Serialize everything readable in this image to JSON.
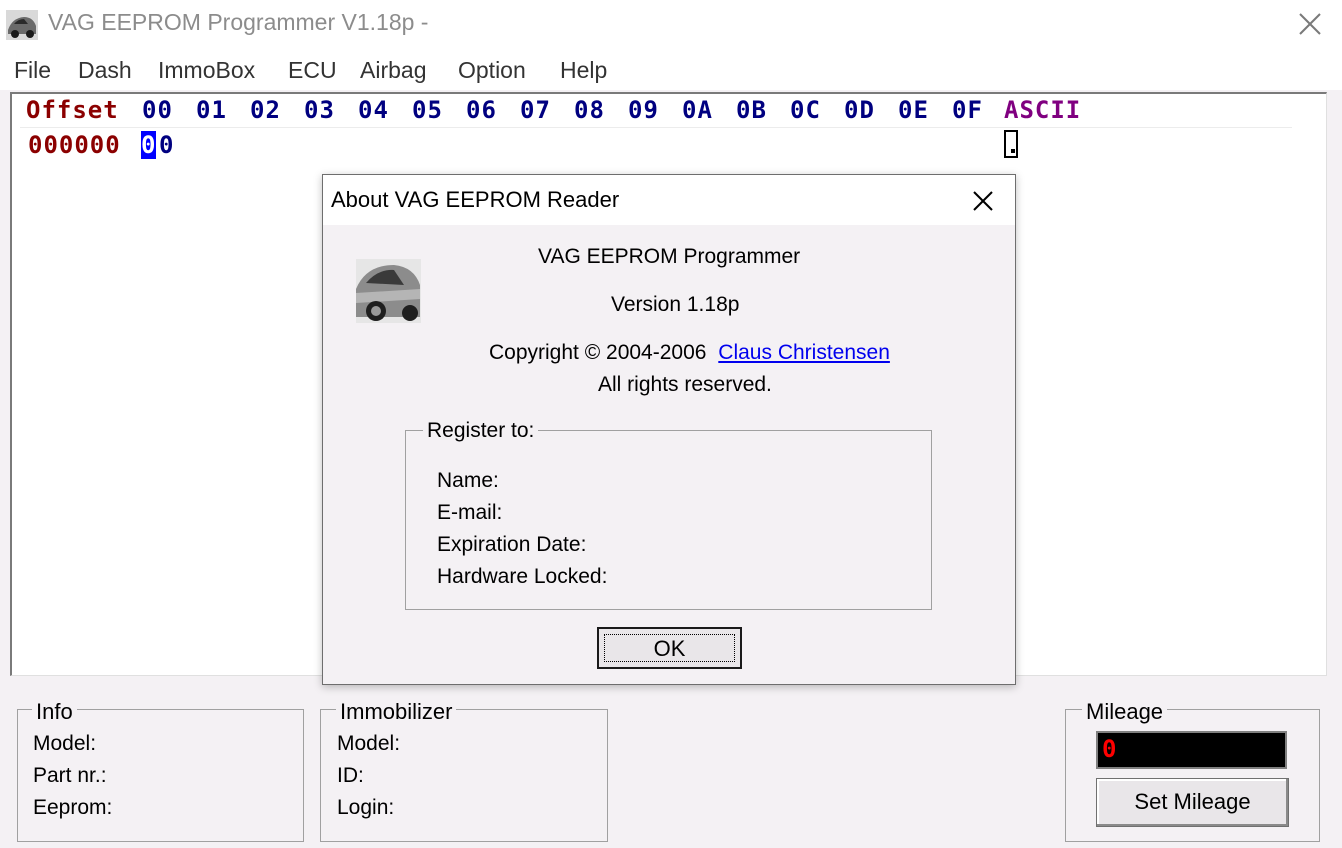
{
  "window": {
    "title": "VAG EEPROM Programmer  V1.18p -"
  },
  "menu": [
    "File",
    "Dash",
    "ImmoBox",
    "ECU",
    "Airbag",
    "Option",
    "Help"
  ],
  "hex": {
    "offset_label": "Offset",
    "columns": [
      "00",
      "01",
      "02",
      "03",
      "04",
      "05",
      "06",
      "07",
      "08",
      "09",
      "0A",
      "0B",
      "0C",
      "0D",
      "0E",
      "0F"
    ],
    "ascii_label": "ASCII",
    "row_offset": "000000",
    "row_byte_selected": "0",
    "row_byte_rest": "0"
  },
  "info": {
    "title": "Info",
    "model": "Model:",
    "part": "Part nr.:",
    "eeprom": "Eeprom:"
  },
  "immobilizer": {
    "title": "Immobilizer",
    "model": "Model:",
    "id": "ID:",
    "login": "Login:"
  },
  "mileage": {
    "title": "Mileage",
    "value": "0",
    "button": "Set Mileage"
  },
  "about": {
    "title": "About VAG EEPROM Reader",
    "product": "VAG EEPROM Programmer",
    "version": "Version 1.18p",
    "copyright": "Copyright © 2004-2006",
    "author_link": "Claus Christensen",
    "rights": "All rights reserved.",
    "register_title": "Register to:",
    "name": "Name:",
    "email": "E-mail:",
    "expiration": "Expiration Date:",
    "hardware": "Hardware Locked:",
    "ok": "OK"
  },
  "colors": {
    "offset_red": "#8b0000",
    "column_blue": "#000080",
    "ascii_purple": "#800080",
    "selection_blue": "#0000ff",
    "mileage_red": "#ff0000"
  },
  "icons": [
    "car-icon",
    "close-icon"
  ]
}
